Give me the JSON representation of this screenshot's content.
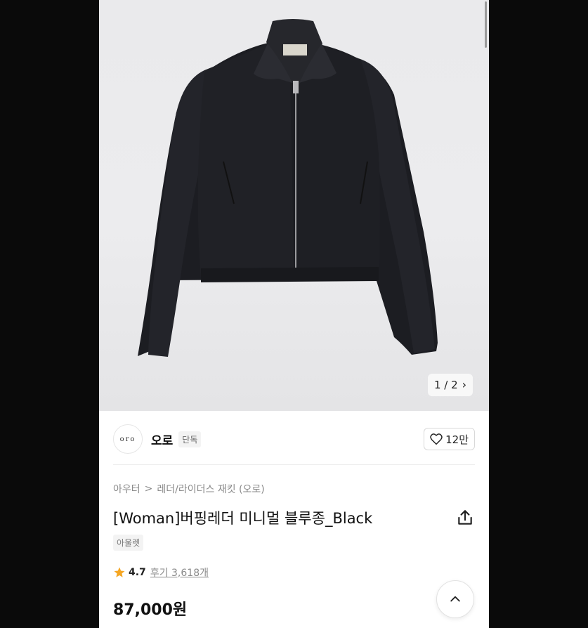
{
  "gallery": {
    "counter": "1 / 2",
    "next_icon": "chevron-right-icon"
  },
  "brand": {
    "logo_text": "oro",
    "name": "오로",
    "tag": "단독"
  },
  "likes": {
    "icon": "heart-icon",
    "count": "12만"
  },
  "breadcrumb": {
    "category": "아우터",
    "separator": ">",
    "subcategory": "레더/라이더스 재킷 (오로)"
  },
  "product": {
    "title": "[Woman]버핑레더 미니멀 블루종_Black",
    "outlet_tag": "아울렛",
    "rating": "4.7",
    "reviews": "후기 3,618개",
    "price": "87,000원"
  },
  "colors": {
    "star": "#f5a623",
    "text": "#111111",
    "muted": "#8a8a8a"
  }
}
